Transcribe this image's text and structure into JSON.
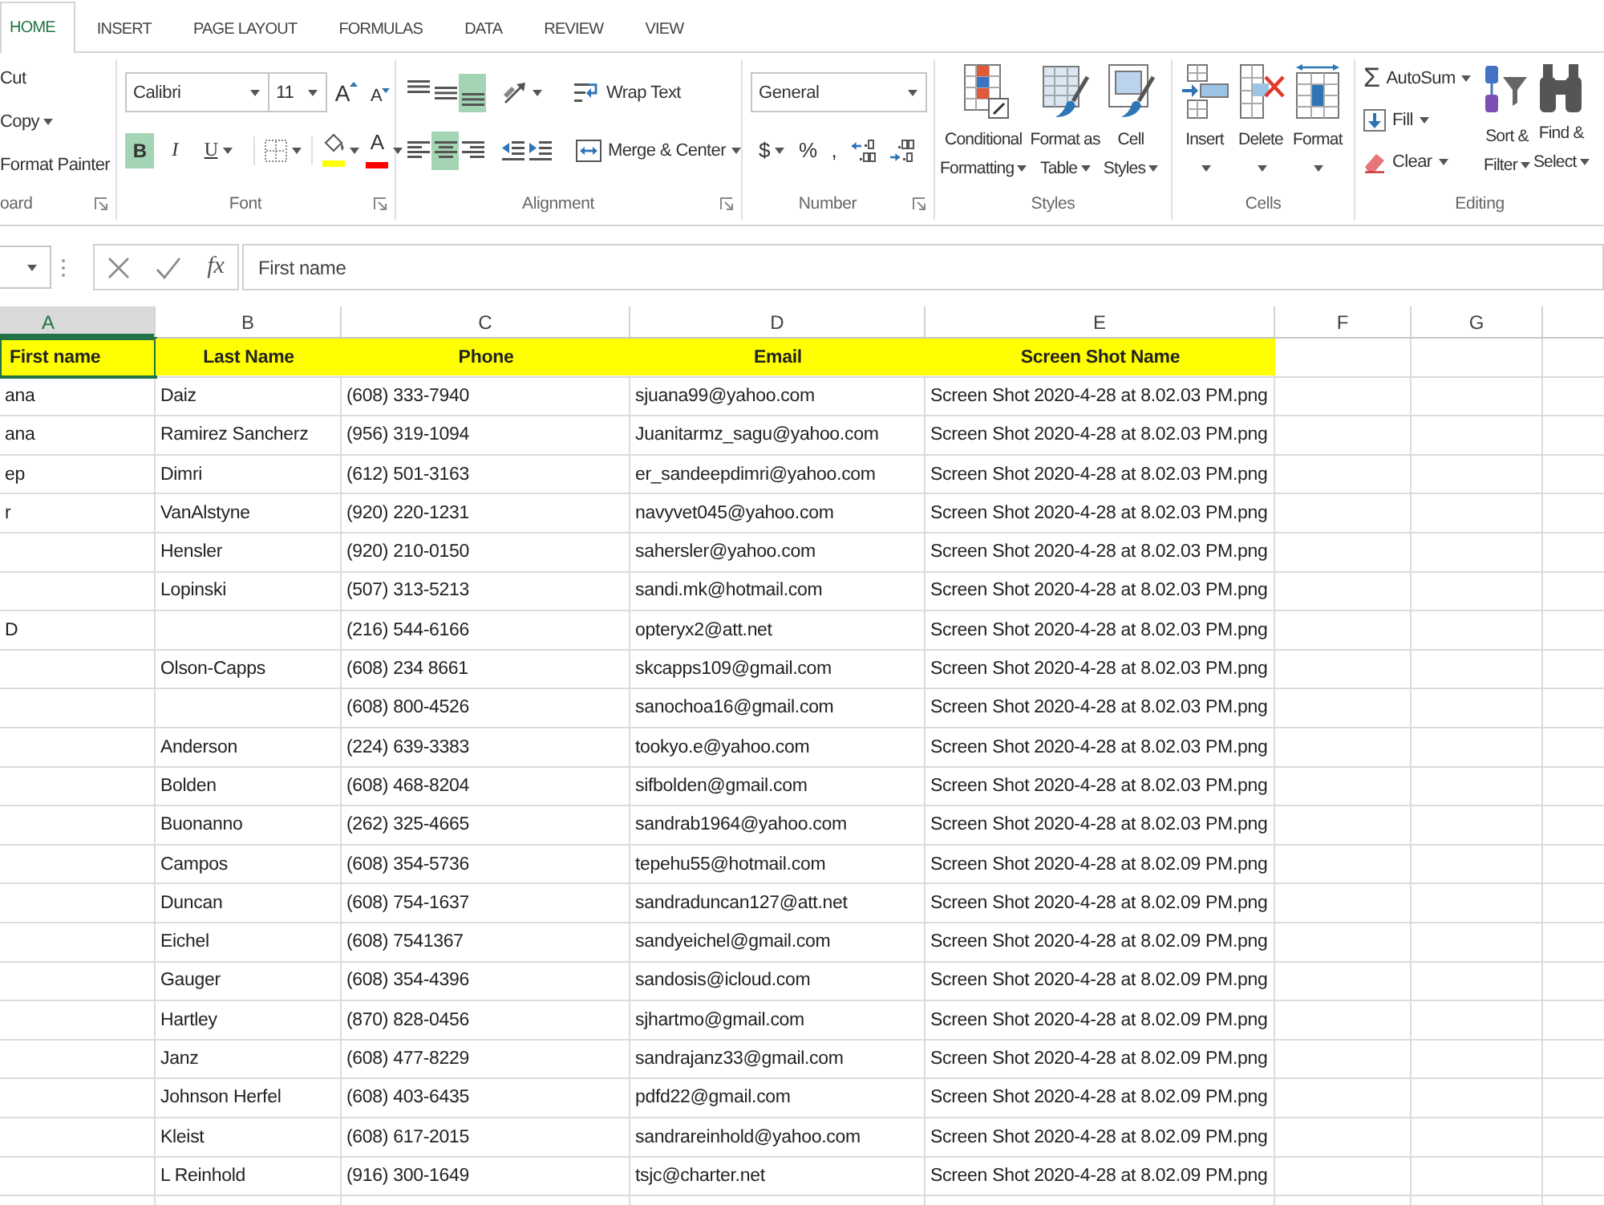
{
  "ribbon_tabs": [
    {
      "label": "HOME",
      "selected": true
    },
    {
      "label": "INSERT",
      "selected": false
    },
    {
      "label": "PAGE LAYOUT",
      "selected": false
    },
    {
      "label": "FORMULAS",
      "selected": false
    },
    {
      "label": "DATA",
      "selected": false
    },
    {
      "label": "REVIEW",
      "selected": false
    },
    {
      "label": "VIEW",
      "selected": false
    }
  ],
  "ribbon_groups": [
    {
      "kind": "clipboard",
      "label": "oard",
      "launcher": true,
      "commands": [
        {
          "label": "Cut"
        },
        {
          "label": "Copy",
          "dropdown": true
        },
        {
          "label": "Format Painter"
        }
      ]
    },
    {
      "kind": "font",
      "label": "Font",
      "launcher": true,
      "font_name": "Calibri",
      "font_size": "11",
      "size_buttons": [
        {
          "kind": "grow",
          "glyph": "A"
        },
        {
          "kind": "shrink",
          "glyph": "A"
        }
      ],
      "toggles": [
        {
          "kind": "bold",
          "glyph": "B",
          "on": true
        },
        {
          "kind": "italic",
          "glyph": "I",
          "on": false
        },
        {
          "kind": "underline",
          "glyph": "U",
          "on": false,
          "dropdown": true
        }
      ],
      "borders": {
        "dropdown": true
      },
      "fill_color": {
        "color": "#ffff00",
        "dropdown": true
      },
      "font_color": {
        "glyph": "A",
        "color": "#ff0000",
        "dropdown": true
      }
    },
    {
      "kind": "alignment",
      "label": "Alignment",
      "launcher": true,
      "vertical": [
        {
          "kind": "top",
          "selected": false
        },
        {
          "kind": "middle",
          "selected": false
        },
        {
          "kind": "bottom",
          "selected": true
        }
      ],
      "orientation": {
        "dropdown": true
      },
      "wrap_text": {
        "label": "Wrap Text"
      },
      "horizontal": [
        {
          "kind": "left",
          "selected": false
        },
        {
          "kind": "center",
          "selected": true
        },
        {
          "kind": "right",
          "selected": false
        }
      ],
      "indent": [
        {
          "kind": "decrease"
        },
        {
          "kind": "increase"
        }
      ],
      "merge": {
        "label": "Merge & Center",
        "dropdown": true
      }
    },
    {
      "kind": "number",
      "label": "Number",
      "launcher": true,
      "format": "General",
      "buttons": [
        {
          "kind": "currency",
          "glyph": "$",
          "dropdown": true
        },
        {
          "kind": "percent",
          "glyph": "%"
        },
        {
          "kind": "comma",
          "glyph": ","
        },
        {
          "kind": "increase_decimal"
        },
        {
          "kind": "decrease_decimal"
        }
      ]
    },
    {
      "kind": "styles",
      "label": "Styles",
      "commands": [
        {
          "kind": "conditional_formatting",
          "lines": [
            "Conditional",
            "Formatting"
          ],
          "dropdown": true
        },
        {
          "kind": "format_as_table",
          "lines": [
            "Format as",
            "Table"
          ],
          "dropdown": true
        },
        {
          "kind": "cell_styles",
          "lines": [
            "Cell",
            "Styles"
          ],
          "dropdown": true
        }
      ]
    },
    {
      "kind": "cells",
      "label": "Cells",
      "commands": [
        {
          "kind": "insert",
          "lines": [
            "Insert"
          ],
          "dropdown": true
        },
        {
          "kind": "delete",
          "lines": [
            "Delete"
          ],
          "dropdown": true
        },
        {
          "kind": "format",
          "lines": [
            "Format"
          ],
          "dropdown": true
        }
      ]
    },
    {
      "kind": "editing",
      "label": "Editing",
      "small": [
        {
          "kind": "autosum",
          "glyph": "Σ",
          "label": "AutoSum",
          "dropdown": true
        },
        {
          "kind": "fill",
          "label": "Fill",
          "dropdown": true
        },
        {
          "kind": "clear",
          "label": "Clear",
          "dropdown": true
        }
      ],
      "commands": [
        {
          "kind": "sort_filter",
          "lines": [
            "Sort &",
            "Filter"
          ],
          "dropdown": true
        },
        {
          "kind": "find_select",
          "lines": [
            "Find &",
            "Select"
          ],
          "dropdown": true
        }
      ]
    }
  ],
  "formula_bar": {
    "function_glyph": "fx",
    "value": "First name"
  },
  "sheet": {
    "columns": [
      {
        "label": "A",
        "selected": true
      },
      {
        "label": "B",
        "selected": false
      },
      {
        "label": "C",
        "selected": false
      },
      {
        "label": "D",
        "selected": false
      },
      {
        "label": "E",
        "selected": false
      },
      {
        "label": "F",
        "selected": false
      },
      {
        "label": "G",
        "selected": false
      }
    ],
    "header_row": [
      {
        "text": "First name",
        "selected": true
      },
      {
        "text": "Last Name",
        "selected": false
      },
      {
        "text": "Phone",
        "selected": false
      },
      {
        "text": "Email",
        "selected": false
      },
      {
        "text": "Screen Shot Name",
        "selected": false
      }
    ],
    "rows": [
      {
        "first_name": "ana",
        "last_name": "Daiz",
        "phone": "(608) 333-7940",
        "email": "sjuana99@yahoo.com",
        "screen_shot_name": "Screen Shot 2020-4-28 at 8.02.03 PM.png"
      },
      {
        "first_name": "ana",
        "last_name": "Ramirez Sancherz",
        "phone": "(956) 319-1094",
        "email": "Juanitarmz_sagu@yahoo.com",
        "screen_shot_name": "Screen Shot 2020-4-28 at 8.02.03 PM.png"
      },
      {
        "first_name": "ep",
        "last_name": "Dimri",
        "phone": "(612) 501-3163",
        "email": "er_sandeepdimri@yahoo.com",
        "screen_shot_name": "Screen Shot 2020-4-28 at 8.02.03 PM.png"
      },
      {
        "first_name": "r",
        "last_name": "VanAlstyne",
        "phone": "(920) 220-1231",
        "email": "navyvet045@yahoo.com",
        "screen_shot_name": "Screen Shot 2020-4-28 at 8.02.03 PM.png"
      },
      {
        "last_name": "Hensler",
        "phone": "(920) 210-0150",
        "email": "sahersler@yahoo.com",
        "screen_shot_name": "Screen Shot 2020-4-28 at 8.02.03 PM.png"
      },
      {
        "last_name": "Lopinski",
        "phone": "(507) 313-5213",
        "email": "sandi.mk@hotmail.com",
        "screen_shot_name": "Screen Shot 2020-4-28 at 8.02.03 PM.png"
      },
      {
        "first_name": "D",
        "phone": "(216) 544-6166",
        "email": "opteryx2@att.net",
        "screen_shot_name": "Screen Shot 2020-4-28 at 8.02.03 PM.png"
      },
      {
        "last_name": "Olson-Capps",
        "phone": "(608) 234 8661",
        "email": "skcapps109@gmail.com",
        "screen_shot_name": "Screen Shot 2020-4-28 at 8.02.03 PM.png"
      },
      {
        "phone": "(608) 800-4526",
        "email": "sanochoa16@gmail.com",
        "screen_shot_name": "Screen Shot 2020-4-28 at 8.02.03 PM.png"
      },
      {
        "last_name": "Anderson",
        "phone": "(224) 639-3383",
        "email": "tookyo.e@yahoo.com",
        "screen_shot_name": "Screen Shot 2020-4-28 at 8.02.03 PM.png"
      },
      {
        "last_name": "Bolden",
        "phone": "(608) 468-8204",
        "email": "sifbolden@gmail.com",
        "screen_shot_name": "Screen Shot 2020-4-28 at 8.02.03 PM.png"
      },
      {
        "last_name": "Buonanno",
        "phone": "(262) 325-4665",
        "email": "sandrab1964@yahoo.com",
        "screen_shot_name": "Screen Shot 2020-4-28 at 8.02.03 PM.png"
      },
      {
        "last_name": "Campos",
        "phone": "(608) 354-5736",
        "email": "tepehu55@hotmail.com",
        "screen_shot_name": "Screen Shot 2020-4-28 at 8.02.09 PM.png"
      },
      {
        "last_name": "Duncan",
        "phone": "(608) 754-1637",
        "email": "sandraduncan127@att.net",
        "screen_shot_name": "Screen Shot 2020-4-28 at 8.02.09 PM.png"
      },
      {
        "last_name": "Eichel",
        "phone": "(608) 7541367",
        "email": "sandyeichel@gmail.com",
        "screen_shot_name": "Screen Shot 2020-4-28 at 8.02.09 PM.png"
      },
      {
        "last_name": "Gauger",
        "phone": "(608) 354-4396",
        "email": "sandosis@icloud.com",
        "screen_shot_name": "Screen Shot 2020-4-28 at 8.02.09 PM.png"
      },
      {
        "last_name": "Hartley",
        "phone": "(870) 828-0456",
        "email": "sjhartmo@gmail.com",
        "screen_shot_name": "Screen Shot 2020-4-28 at 8.02.09 PM.png"
      },
      {
        "last_name": "Janz",
        "phone": "(608) 477-8229",
        "email": "sandrajanz33@gmail.com",
        "screen_shot_name": "Screen Shot 2020-4-28 at 8.02.09 PM.png"
      },
      {
        "last_name": "Johnson Herfel",
        "phone": "(608) 403-6435",
        "email": "pdfd22@gmail.com",
        "screen_shot_name": "Screen Shot 2020-4-28 at 8.02.09 PM.png"
      },
      {
        "last_name": "Kleist",
        "phone": "(608) 617-2015",
        "email": "sandrareinhold@yahoo.com",
        "screen_shot_name": "Screen Shot 2020-4-28 at 8.02.09 PM.png"
      },
      {
        "last_name": "L Reinhold",
        "phone": "(916) 300-1649",
        "email": "tsjc@charter.net",
        "screen_shot_name": "Screen Shot 2020-4-28 at 8.02.09 PM.png"
      }
    ]
  }
}
